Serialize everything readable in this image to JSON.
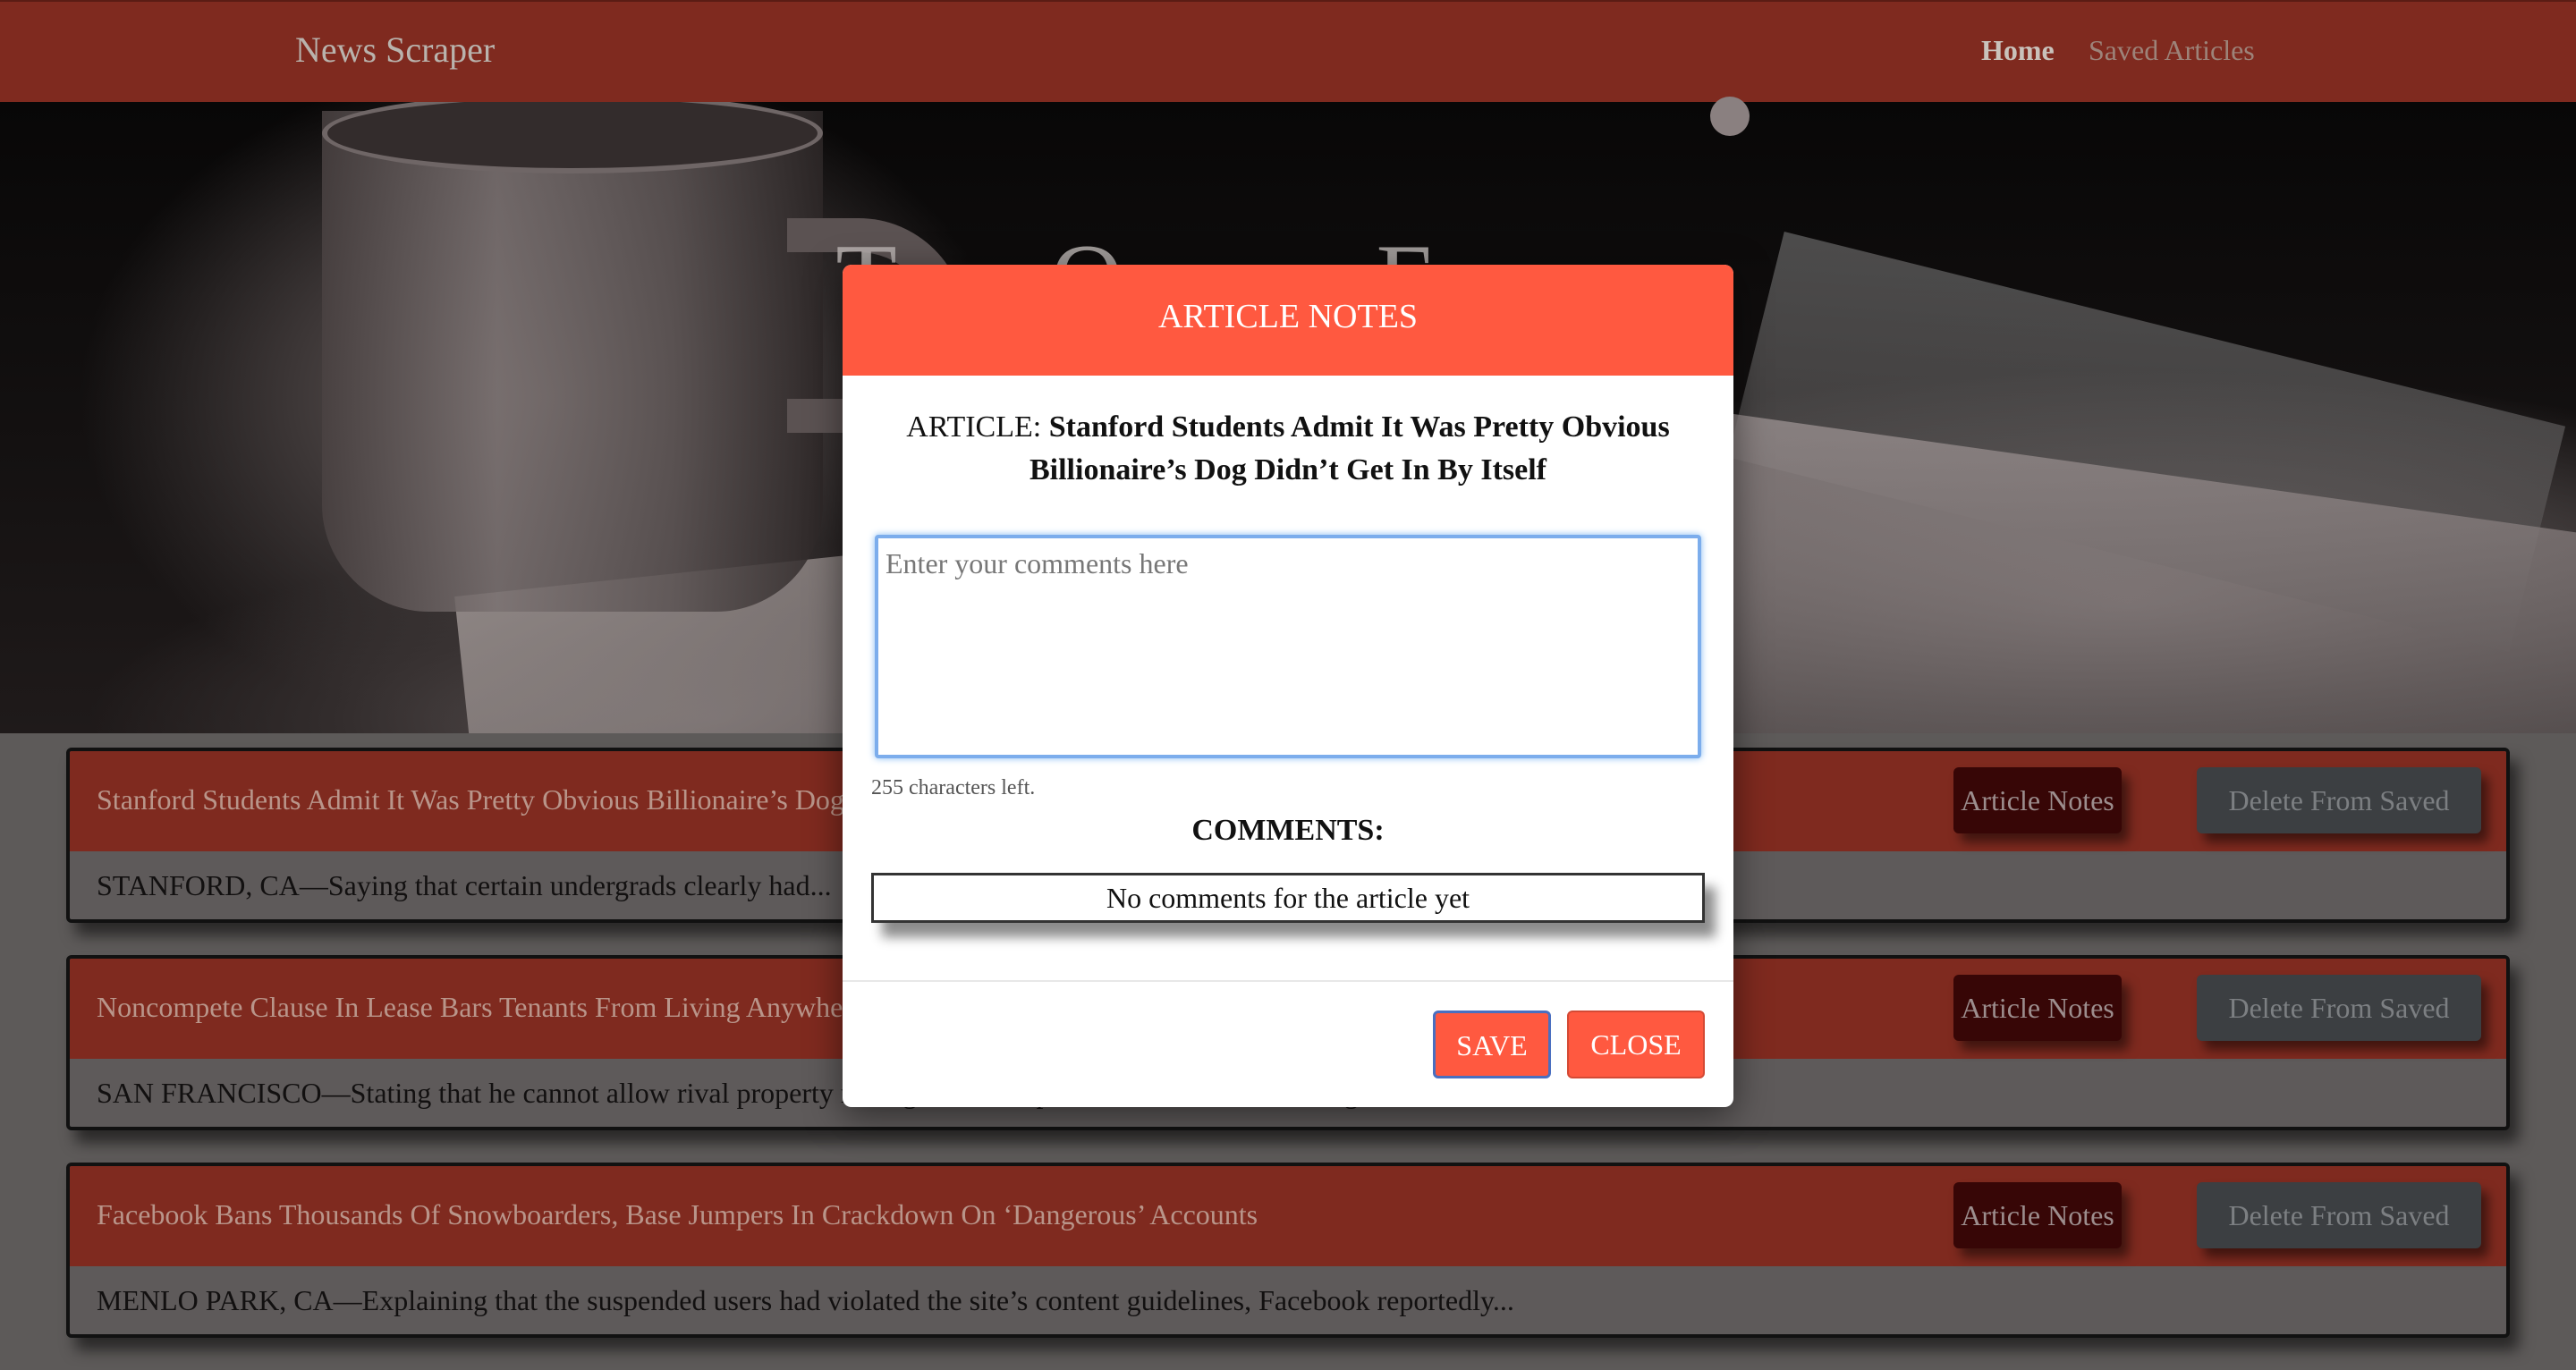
{
  "navbar": {
    "brand": "News Scraper",
    "links": [
      {
        "label": "Home",
        "active": true
      },
      {
        "label": "Saved Articles",
        "active": false
      }
    ]
  },
  "hero": {
    "title": "The Onion Edition"
  },
  "articles": [
    {
      "title": "Stanford Students Admit It Was Pretty Obvious Billionaire’s Dog Didn’t Get In By Itself",
      "summary": "STANFORD, CA—Saying that certain undergrads clearly had...",
      "notes_label": "Article Notes",
      "delete_label": "Delete From Saved"
    },
    {
      "title": "Noncompete Clause In Lease Bars Tenants From Living Anywhere Else",
      "summary": "SAN FRANCISCO—Stating that he cannot allow rival property managers to compete for his tenants’ housing, landlord...",
      "notes_label": "Article Notes",
      "delete_label": "Delete From Saved"
    },
    {
      "title": "Facebook Bans Thousands Of Snowboarders, Base Jumpers In Crackdown On ‘Dangerous’ Accounts",
      "summary": "MENLO PARK, CA—Explaining that the suspended users had violated the site’s content guidelines, Facebook reportedly...",
      "notes_label": "Article Notes",
      "delete_label": "Delete From Saved"
    }
  ],
  "modal": {
    "title": "ARTICLE NOTES",
    "article_prefix": "ARTICLE:",
    "article_title": "Stanford Students Admit It Was Pretty Obvious Billionaire’s Dog Didn’t Get In By Itself",
    "comment_placeholder": "Enter your comments here",
    "comment_value": "",
    "chars_left": "255 characters left.",
    "comments_heading": "COMMENTS:",
    "no_comments": "No comments for the article yet",
    "save_label": "SAVE",
    "close_label": "CLOSE"
  },
  "colors": {
    "navbar": "#7f2a1f",
    "modal_accent": "#ff5940",
    "notes_button": "#370606",
    "delete_button": "#3c3f42"
  }
}
